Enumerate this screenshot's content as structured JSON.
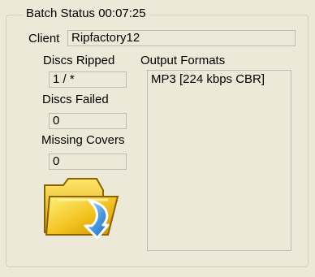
{
  "batch_status": {
    "title": "Batch Status 00:07:25"
  },
  "client": {
    "label": "Client",
    "value": "Ripfactory12"
  },
  "discs_ripped": {
    "label": "Discs Ripped",
    "value": "1 / *"
  },
  "discs_failed": {
    "label": "Discs Failed",
    "value": "0"
  },
  "missing_covers": {
    "label": "Missing Covers",
    "value": "0"
  },
  "output_formats": {
    "label": "Output Formats",
    "items": [
      "MP3 [224 kbps CBR]"
    ]
  },
  "icons": {
    "folder": "folder-download-icon"
  },
  "colors": {
    "window_background": "#ece9d8",
    "groupbox_border": "#d0d0bf",
    "field_border": "#bdbcae",
    "folder_yellow": "#f2c11d",
    "arrow_blue": "#4a98e1"
  }
}
